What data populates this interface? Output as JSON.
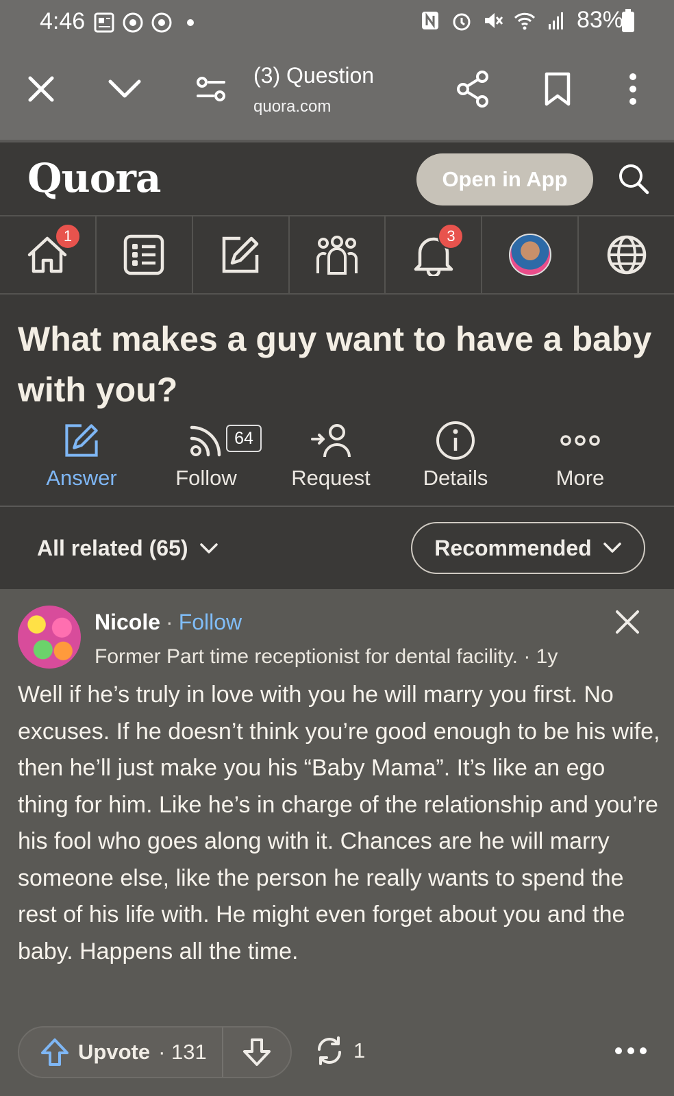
{
  "status_bar": {
    "time": "4:46",
    "battery": "83%",
    "icons": [
      "news-icon",
      "chrome-icon",
      "chrome-icon",
      "dot-icon",
      "nfc-icon",
      "alarm-icon",
      "mute-icon",
      "wifi-icon",
      "signal-icon",
      "battery-icon"
    ]
  },
  "browser": {
    "title": "(3) Question",
    "url": "quora.com",
    "icons": [
      "close-icon",
      "chevron-down-icon",
      "tune-icon",
      "share-icon",
      "bookmark-icon",
      "more-vert-icon"
    ]
  },
  "header": {
    "logo": "Quora",
    "open_app": "Open in App"
  },
  "nav": {
    "items": [
      {
        "icon": "home-icon",
        "badge": "1"
      },
      {
        "icon": "list-icon",
        "badge": ""
      },
      {
        "icon": "edit-icon",
        "badge": ""
      },
      {
        "icon": "people-icon",
        "badge": ""
      },
      {
        "icon": "bell-icon",
        "badge": "3"
      },
      {
        "icon": "profile-avatar",
        "badge": ""
      },
      {
        "icon": "globe-icon",
        "badge": ""
      }
    ]
  },
  "question": {
    "title": "What makes a guy want to have a baby with you?",
    "actions": [
      {
        "label": "Answer",
        "icon": "edit-icon"
      },
      {
        "label": "Follow",
        "icon": "follow-rss-icon",
        "count": "64"
      },
      {
        "label": "Request",
        "icon": "request-person-icon"
      },
      {
        "label": "Details",
        "icon": "info-icon"
      },
      {
        "label": "More",
        "icon": "more-horiz-icon"
      }
    ]
  },
  "filters": {
    "all_related": "All related (65)",
    "sort": "Recommended"
  },
  "answer": {
    "author": "Nicole",
    "separator": "·",
    "follow": "Follow",
    "credential": "Former Part time receptionist for dental facility. · 1y",
    "text": "Well if he’s truly in love with you he will marry you first. No excuses. If he doesn’t think you’re good enough to be his wife, then he’ll just make you his “Baby Mama”. It’s like an ego thing for him. Like he’s in charge of the relationship and you’re his fool who goes along with it. Chances are he will marry someone else, like the person he really wants to spend the rest of his life with. He might even forget about you and the baby. Happens all the time.",
    "upvote_label": "Upvote",
    "upvote_count": "· 131",
    "share_count": "1"
  },
  "colors": {
    "accent_blue": "#7fb7f5",
    "badge_red": "#e8534d",
    "bg_dark": "#3a3937",
    "card_bg": "#5a5955"
  }
}
